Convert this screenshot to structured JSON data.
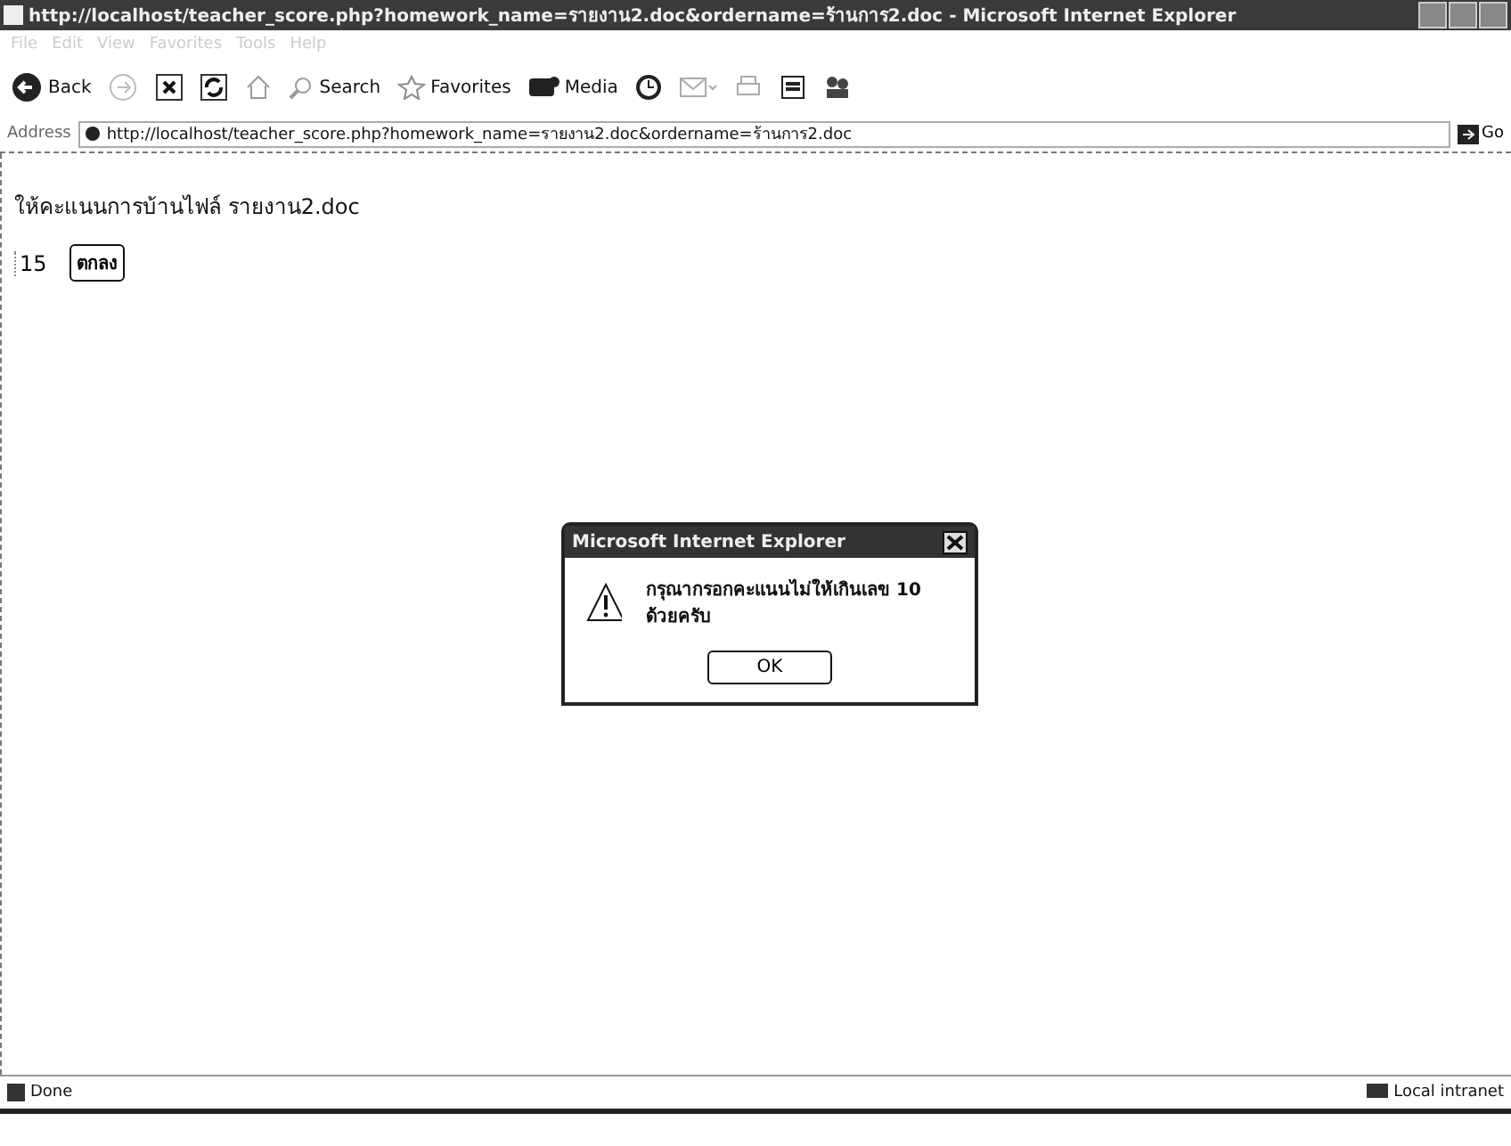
{
  "window": {
    "title": "http://localhost/teacher_score.php?homework_name=รายงาน2.doc&ordername=ร้านการ2.doc - Microsoft Internet Explorer"
  },
  "menu": [
    "File",
    "Edit",
    "View",
    "Favorites",
    "Tools",
    "Help"
  ],
  "toolbar": [
    {
      "kind": "back",
      "label": "Back"
    },
    {
      "kind": "forward"
    },
    {
      "kind": "stop"
    },
    {
      "kind": "refresh"
    },
    {
      "kind": "home"
    },
    {
      "kind": "search",
      "label": "Search"
    },
    {
      "kind": "favorites",
      "label": "Favorites"
    },
    {
      "kind": "media",
      "label": "Media"
    },
    {
      "kind": "history"
    },
    {
      "kind": "mail"
    },
    {
      "kind": "print"
    },
    {
      "kind": "edit"
    },
    {
      "kind": "discuss"
    }
  ],
  "address": {
    "label": "Address",
    "value": "http://localhost/teacher_score.php?homework_name=รายงาน2.doc&ordername=ร้านการ2.doc",
    "go": "Go"
  },
  "page": {
    "heading": "ให้คะแนนการบ้านไฟล์ รายงาน2.doc",
    "score": "15",
    "submit": "ตกลง"
  },
  "dialog": {
    "title": "Microsoft Internet Explorer",
    "message": "กรุณากรอกคะแนนไม่ให้เกินเลข 10 ด้วยครับ",
    "button": "OK"
  },
  "status_bar": {
    "text": "Done",
    "zone": "Local intranet"
  }
}
